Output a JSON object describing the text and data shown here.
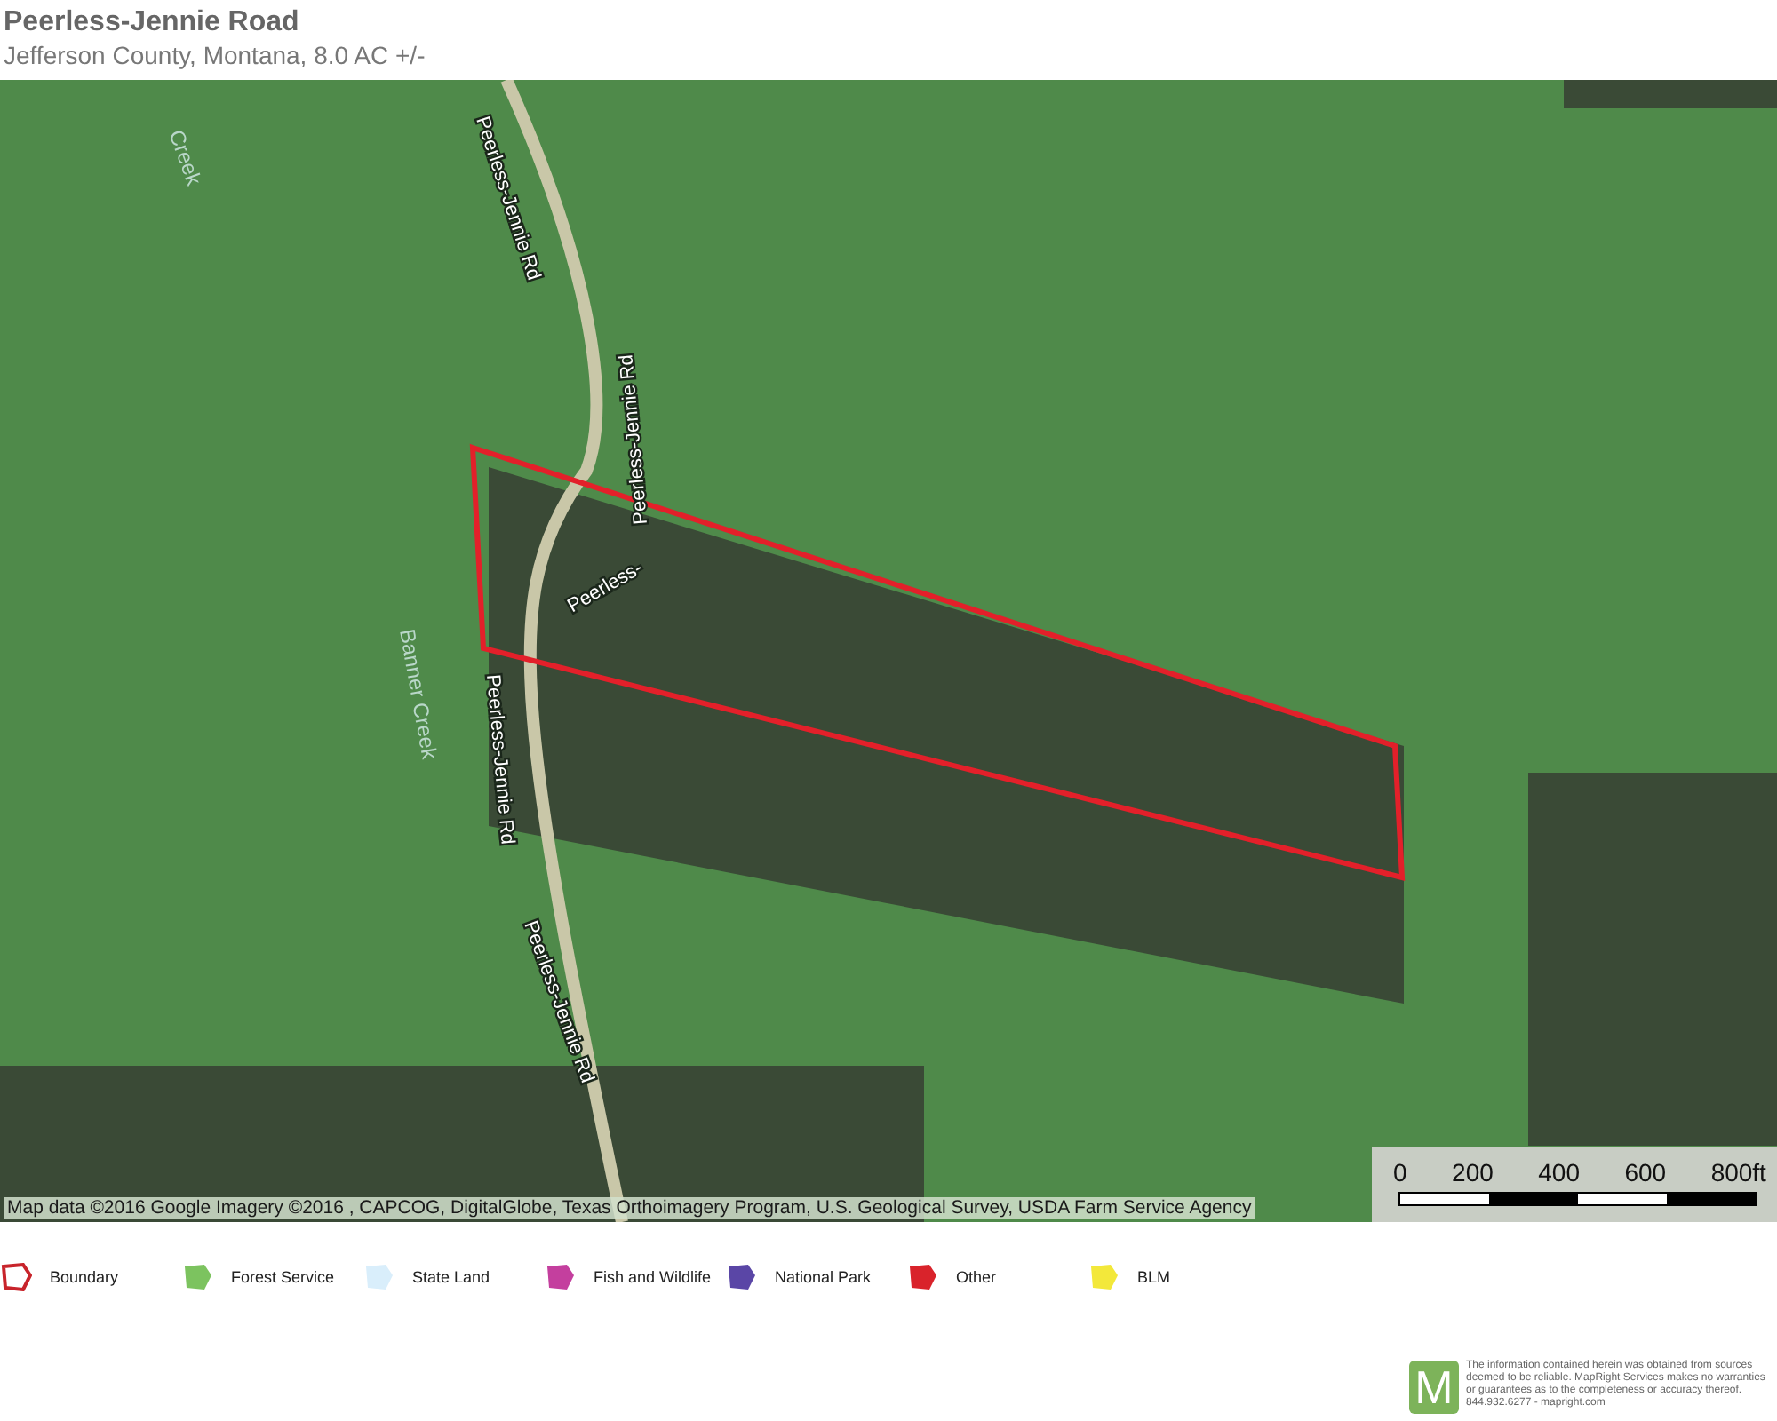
{
  "header": {
    "title": "Peerless-Jennie Road",
    "subtitle": "Jefferson County, Montana, 8.0  AC +/-"
  },
  "map": {
    "labels": [
      {
        "text": "Creek",
        "kind": "water"
      },
      {
        "text": "Peerless-Jennie Rd",
        "kind": "road"
      },
      {
        "text": "Peerless-Jennie Rd",
        "kind": "road"
      },
      {
        "text": "Peerless-",
        "kind": "road"
      },
      {
        "text": "Peerless-Jennie Rd",
        "kind": "road"
      },
      {
        "text": "Peerless-Jennie Rd",
        "kind": "road"
      },
      {
        "text": "Banner Creek",
        "kind": "water"
      }
    ],
    "attribution": "Map data ©2016 Google  Imagery ©2016 , CAPCOG, DigitalGlobe, Texas Orthoimagery Program, U.S. Geological Survey, USDA Farm Service Agency",
    "scale": [
      "0",
      "200",
      "400",
      "600",
      "800ft"
    ]
  },
  "legend": [
    {
      "label": "Boundary",
      "kind": "outline",
      "color": "#c8242b"
    },
    {
      "label": "Forest Service",
      "kind": "fill",
      "color": "#7cc35f"
    },
    {
      "label": "State Land",
      "kind": "fill",
      "color": "#d9eefb"
    },
    {
      "label": "Fish and Wildlife",
      "kind": "fill",
      "color": "#c43f9e"
    },
    {
      "label": "National Park",
      "kind": "fill",
      "color": "#5a46a6"
    },
    {
      "label": "Other",
      "kind": "fill",
      "color": "#d9232b"
    },
    {
      "label": "BLM",
      "kind": "fill",
      "color": "#f3e83a"
    }
  ],
  "footer": {
    "logo": "M",
    "disclaimer": "The information contained herein was obtained from sources deemed to be reliable. MapRight Services makes no warranties or guarantees as to the completeness or accuracy thereof. 844.932.6277 - mapright.com"
  }
}
